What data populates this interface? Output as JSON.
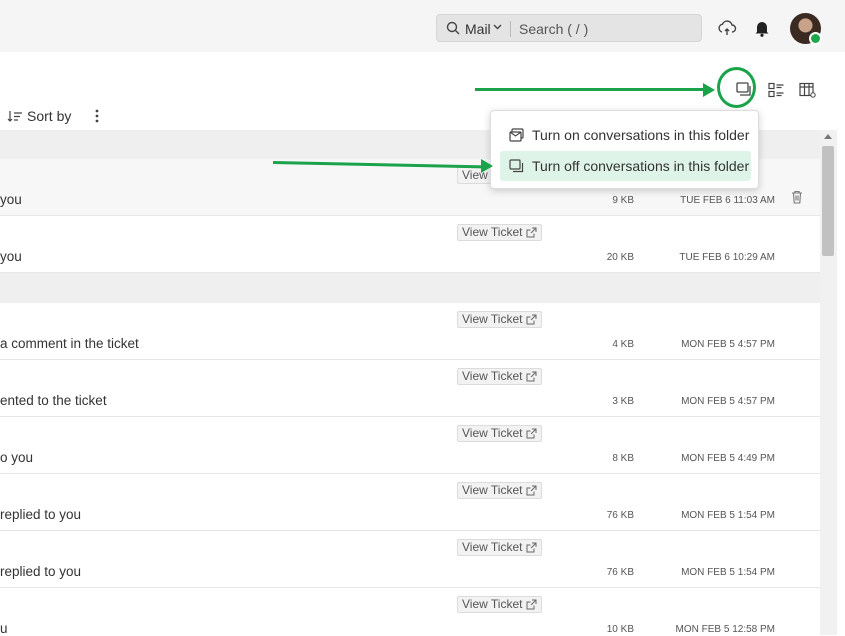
{
  "search": {
    "scope": "Mail",
    "placeholder": "Search ( / )"
  },
  "toolbar": {
    "sort_label": "Sort by"
  },
  "menu": {
    "items": [
      {
        "label": "Turn on conversations in this folder"
      },
      {
        "label": "Turn off conversations in this folder"
      }
    ]
  },
  "rows": [
    {
      "subject": "you",
      "ticket": "View",
      "size": "9 KB",
      "date": "TUE FEB 6 11:03 AM"
    },
    {
      "subject": "you",
      "ticket": "View Ticket",
      "size": "20 KB",
      "date": "TUE FEB 6 10:29 AM"
    },
    {
      "subject": "a comment in the ticket",
      "ticket": "View Ticket",
      "size": "4 KB",
      "date": "MON FEB 5 4:57 PM"
    },
    {
      "subject": "ented to the ticket",
      "ticket": "View Ticket",
      "size": "3 KB",
      "date": "MON FEB 5 4:57 PM"
    },
    {
      "subject": "o you",
      "ticket": "View Ticket",
      "size": "8 KB",
      "date": "MON FEB 5 4:49 PM"
    },
    {
      "subject": "replied to you",
      "ticket": "View Ticket",
      "size": "76 KB",
      "date": "MON FEB 5 1:54 PM"
    },
    {
      "subject": "replied to you",
      "ticket": "View Ticket",
      "size": "76 KB",
      "date": "MON FEB 5 1:54 PM"
    },
    {
      "subject": "u",
      "ticket": "View Ticket",
      "size": "10 KB",
      "date": "MON FEB 5 12:58 PM"
    }
  ],
  "colors": {
    "accent": "#1aa34a",
    "highlight": "#dff4e8"
  }
}
